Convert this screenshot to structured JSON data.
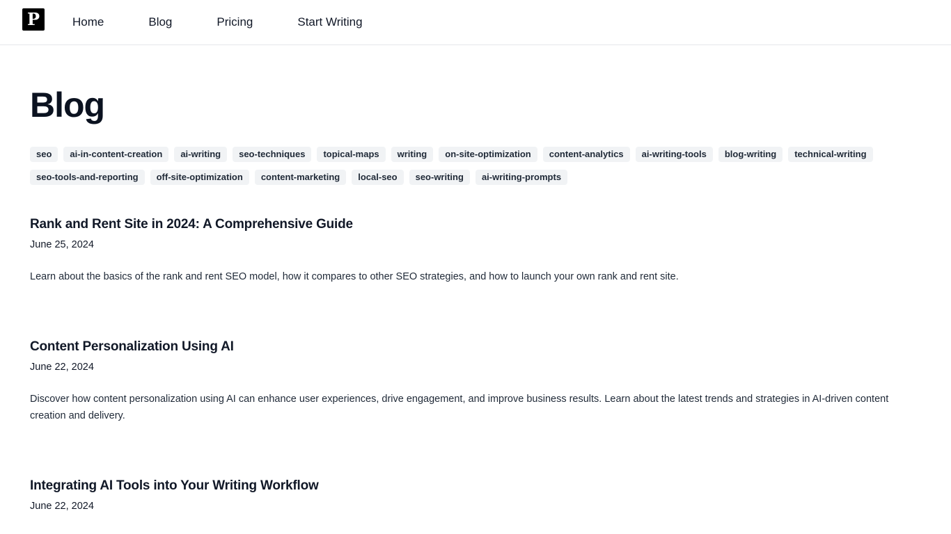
{
  "nav": {
    "logo_letter": "P",
    "links": [
      "Home",
      "Blog",
      "Pricing",
      "Start Writing"
    ]
  },
  "page": {
    "title": "Blog"
  },
  "tags": [
    "seo",
    "ai-in-content-creation",
    "ai-writing",
    "seo-techniques",
    "topical-maps",
    "writing",
    "on-site-optimization",
    "content-analytics",
    "ai-writing-tools",
    "blog-writing",
    "technical-writing",
    "seo-tools-and-reporting",
    "off-site-optimization",
    "content-marketing",
    "local-seo",
    "seo-writing",
    "ai-writing-prompts"
  ],
  "posts": [
    {
      "title": "Rank and Rent Site in 2024: A Comprehensive Guide",
      "date": "June 25, 2024",
      "excerpt": "Learn about the basics of the rank and rent SEO model, how it compares to other SEO strategies, and how to launch your own rank and rent site."
    },
    {
      "title": "Content Personalization Using AI",
      "date": "June 22, 2024",
      "excerpt": "Discover how content personalization using AI can enhance user experiences, drive engagement, and improve business results. Learn about the latest trends and strategies in AI-driven content creation and delivery."
    },
    {
      "title": "Integrating AI Tools into Your Writing Workflow",
      "date": "June 22, 2024",
      "excerpt": ""
    }
  ]
}
